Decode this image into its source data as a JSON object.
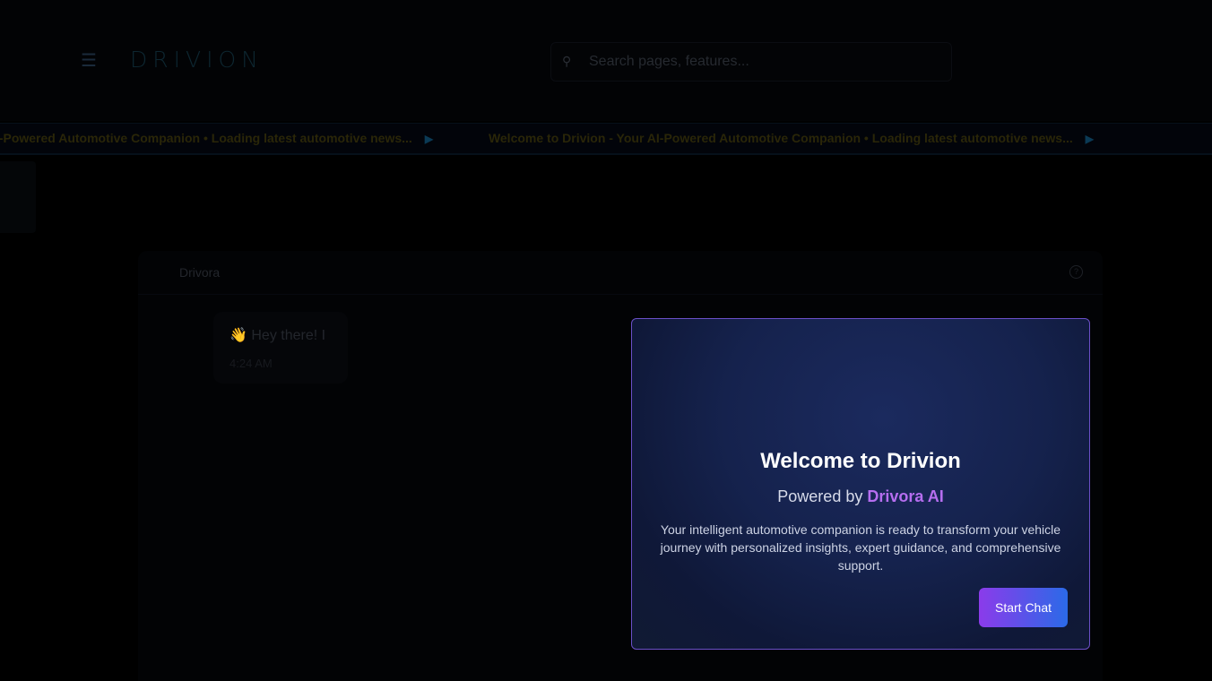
{
  "header": {
    "logo": "DRIVION",
    "menu_icon": "hamburger-icon",
    "search": {
      "placeholder": "Search pages, features...",
      "value": "",
      "icon": "search-icon"
    }
  },
  "ticker": {
    "items": [
      "Welcome to Drivion - Your AI-Powered Automotive Companion • Loading latest automotive news...",
      "Welcome to Drivion - Your AI-Powered Automotive Companion • Loading latest automotive news..."
    ],
    "partial": "r AI-Powered Automotive Companion • Loading latest automotive news..."
  },
  "chat": {
    "title": "Drivora",
    "messages": [
      {
        "text": "👋 Hey there! I",
        "time": "4:24 AM"
      }
    ]
  },
  "modal": {
    "title": "Welcome to Drivion",
    "powered_prefix": "Powered by",
    "powered_brand": "Drivora AI",
    "description": "Your intelligent automotive companion is ready to transform your vehicle journey with personalized insights, expert guidance, and comprehensive support.",
    "button": "Start Chat"
  },
  "colors": {
    "accent_purple": "#8b3bea",
    "accent_blue": "#2b6ae8",
    "brand": "#b66ef0"
  }
}
